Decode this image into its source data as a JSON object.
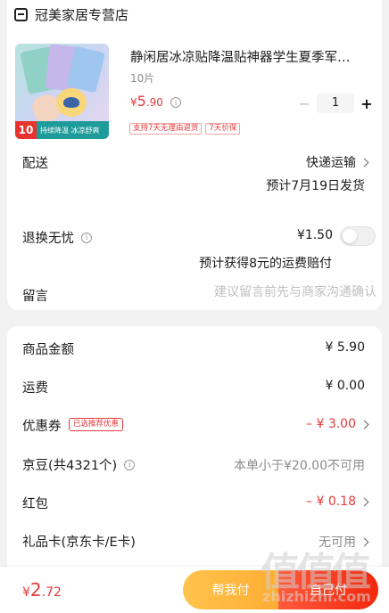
{
  "shop": {
    "name": "冠美家居专营店",
    "icon": "store-icon"
  },
  "product": {
    "title": "静闲居冰凉贴降温贴神器学生夏季军…",
    "spec": "10片",
    "price_currency": "¥",
    "price_int": "5",
    "price_dec": ".90",
    "quantity": "1",
    "thumb_banner_num": "10",
    "thumb_banner_text": "持续降温 冰凉舒爽",
    "tags": [
      "支持7天无理由退货",
      "7天价保"
    ]
  },
  "delivery": {
    "label": "配送",
    "method": "快递运输",
    "estimate": "预计7月19日发货"
  },
  "return_insurance": {
    "label": "退换无忧",
    "price": "¥1.50",
    "note": "预计获得8元的运费赔付"
  },
  "message": {
    "label": "留言",
    "placeholder": "建议留言前先与商家沟通确认"
  },
  "summary": {
    "goods_label": "商品金额",
    "goods_value": "¥ 5.90",
    "shipping_label": "运费",
    "shipping_value": "¥ 0.00",
    "coupon_label": "优惠券",
    "coupon_tag": "已选推荐优惠",
    "coupon_value": "– ¥ 3.00",
    "jingdou_label": "京豆(共4321个)",
    "jingdou_value": "本单小于¥20.00不可用",
    "hongbao_label": "红包",
    "hongbao_value": "– ¥ 0.18",
    "giftcard_label": "礼品卡(京东卡/E卡)",
    "giftcard_value": "无可用"
  },
  "footer": {
    "total_currency": "¥",
    "total_int": "2",
    "total_dec": ".72",
    "help_pay": "帮我付",
    "pay": "自己付"
  },
  "watermark": {
    "glyphs": "值值值",
    "url": "zhizhizhi.com"
  },
  "colors": {
    "accent": "#e4393c",
    "help_btn": "#ffb63e",
    "pay_btn": "#f2270c"
  }
}
